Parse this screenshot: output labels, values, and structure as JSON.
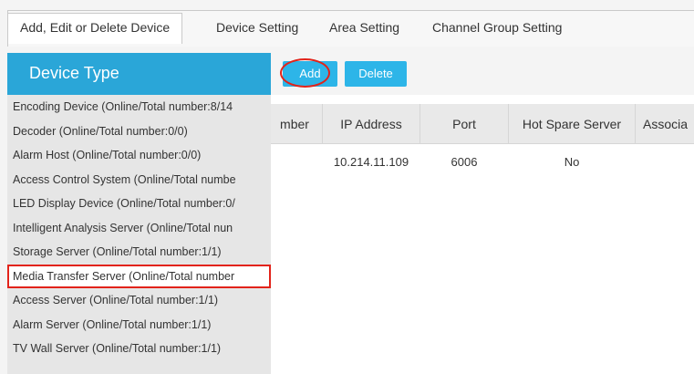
{
  "tabs": [
    {
      "label": "Add, Edit or Delete Device",
      "active": true
    },
    {
      "label": "Device Setting",
      "active": false
    },
    {
      "label": "Area Setting",
      "active": false
    },
    {
      "label": "Channel Group Setting",
      "active": false
    }
  ],
  "left_panel": {
    "title": "Device Type",
    "items": [
      {
        "label": "Encoding Device (Online/Total number:8/14",
        "selected": false
      },
      {
        "label": "Decoder (Online/Total number:0/0)",
        "selected": false
      },
      {
        "label": "Alarm Host (Online/Total number:0/0)",
        "selected": false
      },
      {
        "label": "Access Control System (Online/Total numbe",
        "selected": false
      },
      {
        "label": "LED Display Device (Online/Total number:0/",
        "selected": false
      },
      {
        "label": "Intelligent Analysis Server (Online/Total nun",
        "selected": false
      },
      {
        "label": "Storage Server (Online/Total number:1/1)",
        "selected": false
      },
      {
        "label": "Media Transfer Server (Online/Total number",
        "selected": true
      },
      {
        "label": "Access Server (Online/Total number:1/1)",
        "selected": false
      },
      {
        "label": "Alarm Server (Online/Total number:1/1)",
        "selected": false
      },
      {
        "label": "TV Wall Server (Online/Total number:1/1)",
        "selected": false
      }
    ]
  },
  "toolbar": {
    "add_label": "Add",
    "delete_label": "Delete"
  },
  "table": {
    "columns": [
      "mber",
      "IP Address",
      "Port",
      "Hot Spare Server",
      "Associa"
    ],
    "rows": [
      {
        "ip": "10.214.11.109",
        "port": "6006",
        "hot_spare": "No"
      }
    ]
  },
  "colors": {
    "header_blue": "#2aa6d8",
    "button_blue": "#2db5e8",
    "highlight_red": "#e2231a"
  }
}
